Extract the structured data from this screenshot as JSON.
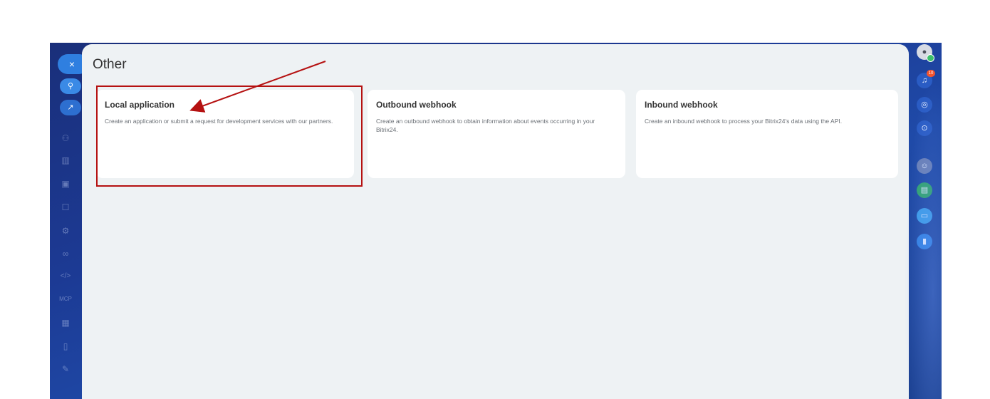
{
  "left_rail": {
    "close_symbol": "×",
    "items": [
      {
        "icon": "link-icon",
        "glyph": "⚲"
      },
      {
        "icon": "external-link-icon",
        "glyph": "↗"
      },
      {
        "icon": "users-icon",
        "glyph": "⚇"
      },
      {
        "icon": "bar-chart-icon",
        "glyph": "▥"
      },
      {
        "icon": "wallet-icon",
        "glyph": "▣"
      },
      {
        "icon": "robot-icon",
        "glyph": "☐"
      },
      {
        "icon": "settings-icon",
        "glyph": "⚙"
      },
      {
        "icon": "binoculars-icon",
        "glyph": "∞"
      },
      {
        "icon": "code-icon",
        "glyph": "</>"
      },
      {
        "icon": "mcp-icon",
        "glyph": "MCP"
      },
      {
        "icon": "calendar-icon",
        "glyph": "▦"
      },
      {
        "icon": "document-icon",
        "glyph": "▯"
      },
      {
        "icon": "pencil-icon",
        "glyph": "✎"
      }
    ]
  },
  "slider": {
    "title": "Other",
    "cards": [
      {
        "title": "Local application",
        "description": "Create an application or submit a request for development services with our partners."
      },
      {
        "title": "Outbound webhook",
        "description": "Create an outbound webhook to obtain information about events occurring in your Bitrix24."
      },
      {
        "title": "Inbound webhook",
        "description": "Create an inbound webhook to process your Bitrix24's data using the API."
      }
    ]
  },
  "right_rail": {
    "notification_count": "10",
    "items": [
      "user-avatar-icon",
      "bell-icon",
      "copilot-icon",
      "search-icon",
      "contact-avatar-icon",
      "calculator-icon",
      "chat-icon",
      "bookmark-icon"
    ]
  },
  "annotation": {
    "color": "#b51111",
    "target": "Local application"
  },
  "colors": {
    "rail_background": "#1c3a94",
    "panel_background": "#eef2f4",
    "card_background": "#ffffff",
    "accent_blue": "#2f7fe0"
  }
}
